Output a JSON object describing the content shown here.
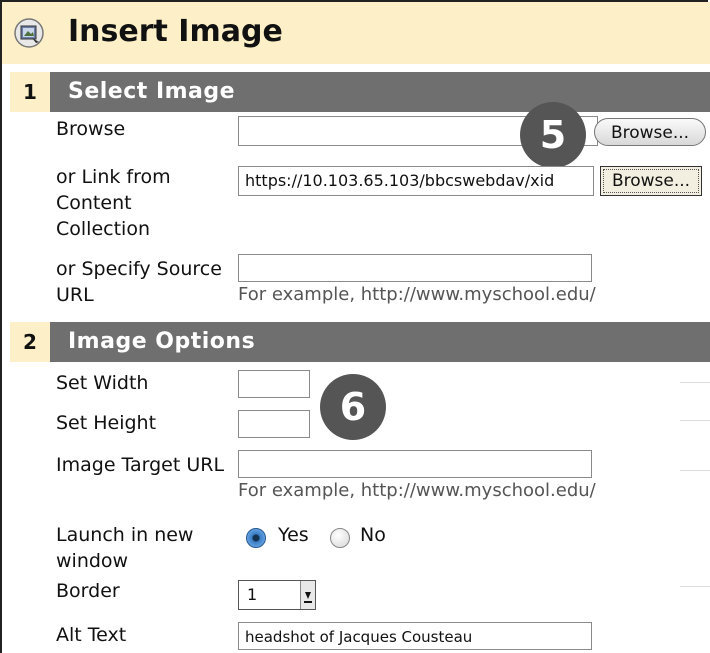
{
  "header": {
    "title": "Insert Image",
    "icon": "insert-image-icon"
  },
  "sections": [
    {
      "number": "1",
      "title": "Select Image"
    },
    {
      "number": "2",
      "title": "Image Options"
    }
  ],
  "select_image": {
    "browse_label": "Browse",
    "browse_value": "",
    "browse_button": "Browse...",
    "link_label_1": "or Link from",
    "link_label_2": "Content",
    "link_label_3": "Collection",
    "link_value": "https://10.103.65.103/bbcswebdav/xid",
    "link_button": "Browse...",
    "source_label_1": "or Specify Source",
    "source_label_2": "URL",
    "source_value": "",
    "source_hint": "For example, http://www.myschool.edu/"
  },
  "image_options": {
    "width_label": "Set Width",
    "width_value": "",
    "height_label": "Set Height",
    "height_value": "",
    "target_label": "Image Target URL",
    "target_value": "",
    "target_hint": "For example, http://www.myschool.edu/",
    "launch_label_1": "Launch in new",
    "launch_label_2": "window",
    "launch_yes": "Yes",
    "launch_no": "No",
    "launch_selected": "Yes",
    "border_label": "Border",
    "border_value": "1",
    "alt_label": "Alt Text",
    "alt_value": "headshot of Jacques Cousteau"
  },
  "callouts": {
    "five": "5",
    "six": "6"
  },
  "colors": {
    "header_bg": "#fdf0c8",
    "section_bar": "#6f6f6f",
    "callout": "#555555"
  }
}
